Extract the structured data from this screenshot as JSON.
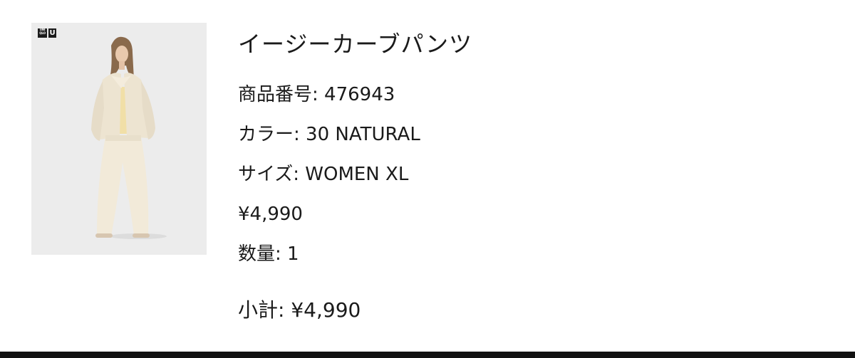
{
  "product": {
    "image_alt": "model wearing natural colored pants",
    "logo": {
      "brand_lines": [
        "UNI",
        "QLO"
      ],
      "line_mark": "U"
    },
    "name": "イージーカーブパンツ",
    "code_label": "商品番号",
    "code_value": "476943",
    "color_label": "カラー",
    "color_value": "30 NATURAL",
    "size_label": "サイズ",
    "size_value": "WOMEN XL",
    "price": "¥4,990",
    "quantity_label": "数量",
    "quantity_value": "1",
    "subtotal_label": "小計",
    "subtotal_value": "¥4,990"
  },
  "colors": {
    "image_background": "#ececec",
    "garment": "#efe6d4",
    "text": "#1a1a1a",
    "rule": "#111111"
  }
}
